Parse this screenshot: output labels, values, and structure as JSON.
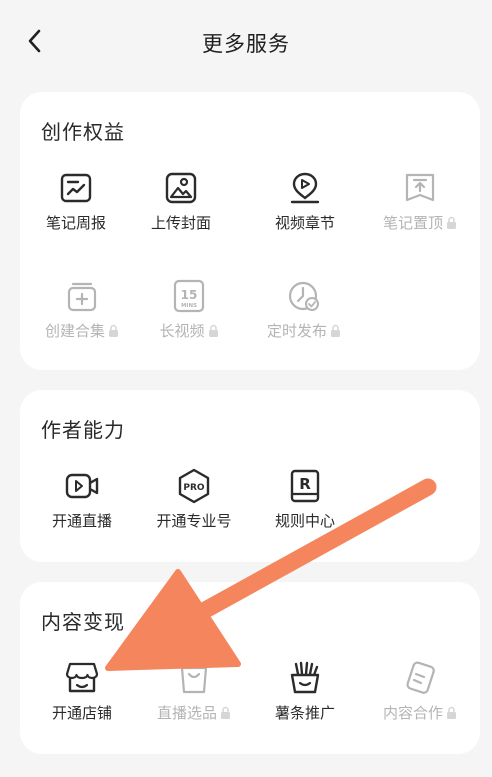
{
  "header": {
    "title": "更多服务",
    "back_icon": "chevron-left-icon"
  },
  "sections": [
    {
      "title": "创作权益",
      "items": [
        {
          "label": "笔记周报",
          "icon": "report-icon",
          "locked": false
        },
        {
          "label": "上传封面",
          "icon": "image-icon",
          "locked": false
        },
        {
          "label": "视频章节",
          "icon": "video-chapter-icon",
          "locked": false
        },
        {
          "label": "笔记置顶",
          "icon": "pin-top-icon",
          "locked": true
        },
        {
          "label": "创建合集",
          "icon": "collection-icon",
          "locked": true
        },
        {
          "label": "长视频",
          "icon": "15-mins-icon",
          "locked": true
        },
        {
          "label": "定时发布",
          "icon": "schedule-clock-icon",
          "locked": true
        }
      ]
    },
    {
      "title": "作者能力",
      "items": [
        {
          "label": "开通直播",
          "icon": "live-video-icon",
          "locked": false
        },
        {
          "label": "开通专业号",
          "icon": "pro-badge-icon",
          "locked": false
        },
        {
          "label": "规则中心",
          "icon": "rule-book-icon",
          "locked": false
        }
      ]
    },
    {
      "title": "内容变现",
      "items": [
        {
          "label": "开通店铺",
          "icon": "shop-icon",
          "locked": false
        },
        {
          "label": "直播选品",
          "icon": "shopping-bag-icon",
          "locked": true
        },
        {
          "label": "薯条推广",
          "icon": "fries-icon",
          "locked": false
        },
        {
          "label": "内容合作",
          "icon": "cooperation-icon",
          "locked": true
        }
      ]
    }
  ],
  "annotation": {
    "color": "#f5855c"
  },
  "colors": {
    "enabled_text": "#2b2b2b",
    "disabled_text": "#b4b4b4",
    "card_bg": "#ffffff",
    "page_bg": "#f5f5f5"
  },
  "icon_text": {
    "pro": "PRO",
    "fifteen": "15",
    "mins": "MINS",
    "rule": "R"
  }
}
